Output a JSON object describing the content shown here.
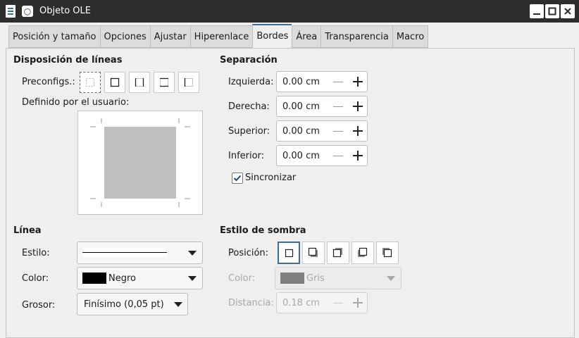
{
  "window": {
    "title": "Objeto OLE"
  },
  "tabs": [
    {
      "label": "Posición y tamaño"
    },
    {
      "label": "Opciones"
    },
    {
      "label": "Ajustar"
    },
    {
      "label": "Hiperenlace"
    },
    {
      "label": "Bordes",
      "active": true
    },
    {
      "label": "Área"
    },
    {
      "label": "Transparencia"
    },
    {
      "label": "Macro"
    }
  ],
  "line_arrangement": {
    "heading": "Disposición de líneas",
    "presets_label": "Preconfigs.:",
    "user_defined_label": "Definido por el usuario:"
  },
  "padding": {
    "heading": "Separación",
    "left_label": "Izquierda:",
    "left_value": "0.00 cm",
    "right_label": "Derecha:",
    "right_value": "0.00 cm",
    "top_label": "Superior:",
    "top_value": "0.00 cm",
    "bottom_label": "Inferior:",
    "bottom_value": "0.00 cm",
    "sync_label": "Sincronizar",
    "sync_checked": true
  },
  "line": {
    "heading": "Línea",
    "style_label": "Estilo:",
    "color_label": "Color:",
    "color_value": "Negro",
    "color_swatch": "#000000",
    "width_label": "Grosor:",
    "width_value": "Finísimo (0,05 pt)"
  },
  "shadow": {
    "heading": "Estilo de sombra",
    "position_label": "Posición:",
    "color_label": "Color:",
    "color_value": "Gris",
    "color_swatch": "#808080",
    "distance_label": "Distancia:",
    "distance_value": "0.18 cm"
  }
}
